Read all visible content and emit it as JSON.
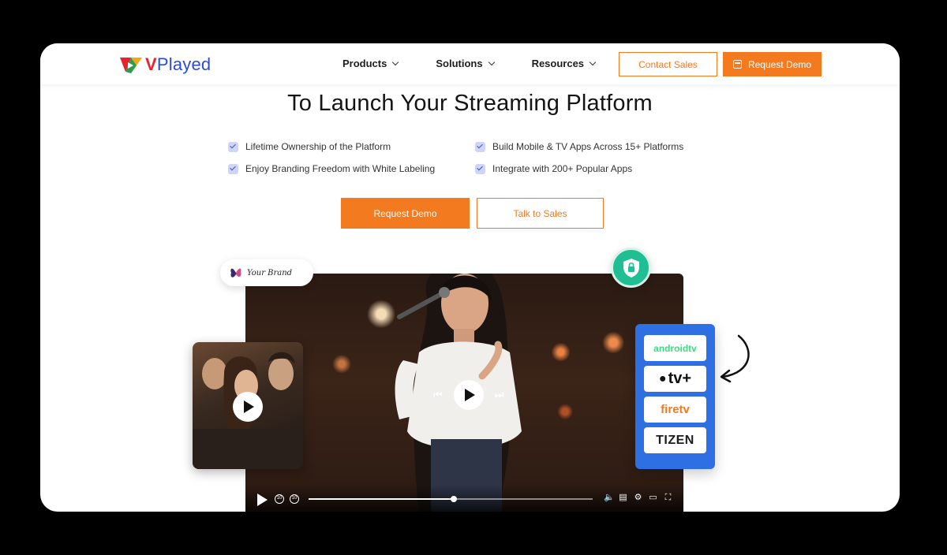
{
  "nav": {
    "logo_text_v": "V",
    "logo_text_rest": "Played",
    "menu": [
      {
        "label": "Products"
      },
      {
        "label": "Solutions"
      },
      {
        "label": "Resources"
      }
    ],
    "contact_sales": "Contact Sales",
    "request_demo": "Request Demo"
  },
  "hero": {
    "title": "To Launch Your Streaming Platform",
    "features": [
      "Lifetime Ownership of the Platform",
      "Build Mobile & TV Apps Across 15+ Platforms",
      "Enjoy Branding Freedom with White Labeling",
      "Integrate with 200+ Popular Apps"
    ],
    "request_demo": "Request Demo",
    "talk_to_sales": "Talk to Sales"
  },
  "brand_badge": "Your Brand",
  "platforms": [
    "androidtv",
    "tv+",
    "firetv",
    "TIZEN"
  ],
  "video": {
    "progress": 0.51
  },
  "colors": {
    "accent": "#f47a20",
    "brand_blue": "#2d4bd6",
    "platform_panel": "#2f6fe4",
    "shield": "#1fbf93"
  }
}
